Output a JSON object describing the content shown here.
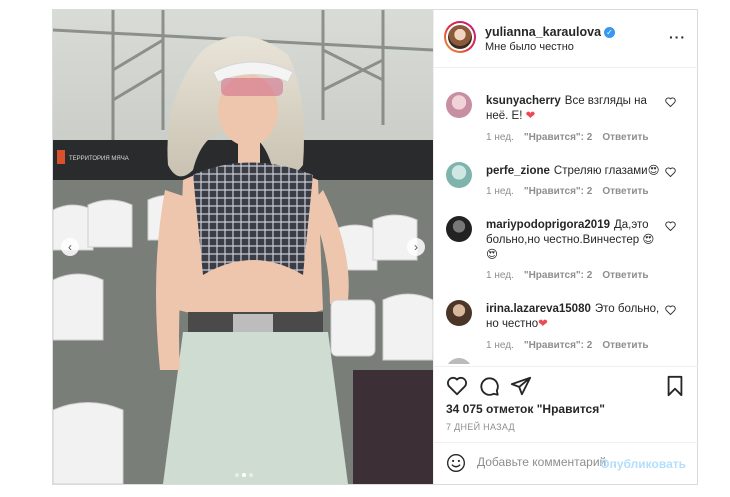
{
  "post": {
    "username": "yulianna_karaulova",
    "caption": "Мне было честно",
    "verified_icon": "verified-badge-icon",
    "more_icon": "more-options-icon",
    "photo_sign": "ТЕРРИТОРИЯ МЯЧА"
  },
  "comments": [
    {
      "user": "ksunyacherry",
      "text": "Все взгляды на неё. Е!",
      "emoji": "❤",
      "time": "1 нед.",
      "likes": "\"Нравится\": 2",
      "reply": "Ответить"
    },
    {
      "user": "perfe_zione",
      "text": "Стреляю глазами",
      "emoji": "😍",
      "time": "1 нед.",
      "likes": "\"Нравится\": 2",
      "reply": "Ответить"
    },
    {
      "user": "mariypodoprigora2019",
      "text": "Да,это больно,но честно.Винчестер",
      "emoji": "😍😍",
      "time": "1 нед.",
      "likes": "\"Нравится\": 2",
      "reply": "Ответить"
    },
    {
      "user": "irina.lazareva15080",
      "text": "Это больно, но честно",
      "emoji": "❤",
      "time": "1 нед.",
      "likes": "\"Нравится\": 2",
      "reply": "Ответить"
    }
  ],
  "stats": {
    "likes": "34 075 отметок \"Нравится\"",
    "date": "7 ДНЕЙ НАЗАД"
  },
  "add_comment": {
    "placeholder": "Добавьте комментарий...",
    "publish": "Опубликовать"
  },
  "colors": {
    "accent": "#3897f0",
    "publish_disabled": "#b2dffc",
    "heart": "#ed4956"
  }
}
